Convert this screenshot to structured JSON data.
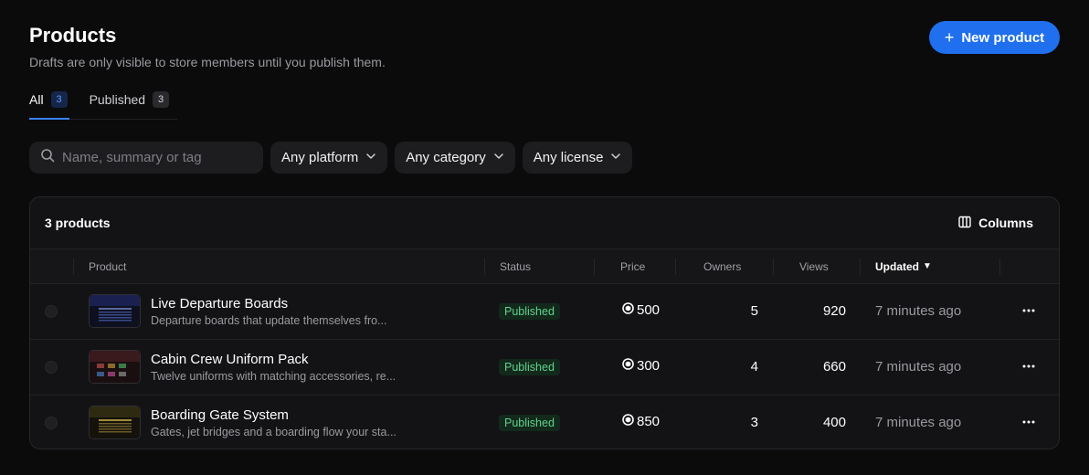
{
  "header": {
    "title": "Products",
    "subtitle": "Drafts are only visible to store members until you publish them.",
    "new_button": "New product"
  },
  "tabs": [
    {
      "label": "All",
      "count": "3",
      "active": true
    },
    {
      "label": "Published",
      "count": "3",
      "active": false
    }
  ],
  "filters": {
    "search_placeholder": "Name, summary or tag",
    "platform": "Any platform",
    "category": "Any category",
    "license": "Any license"
  },
  "table": {
    "count_label": "3 products",
    "columns_button": "Columns",
    "headers": {
      "product": "Product",
      "status": "Status",
      "price": "Price",
      "owners": "Owners",
      "views": "Views",
      "updated": "Updated"
    },
    "sort_indicator": "▼",
    "rows": [
      {
        "name": "Live Departure Boards",
        "summary": "Departure boards that update themselves fro...",
        "status": "Published",
        "price": "500",
        "owners": "5",
        "views": "920",
        "updated": "7 minutes ago",
        "thumb_accent": "#3a4a8a"
      },
      {
        "name": "Cabin Crew Uniform Pack",
        "summary": "Twelve uniforms with matching accessories, re...",
        "status": "Published",
        "price": "300",
        "owners": "4",
        "views": "660",
        "updated": "7 minutes ago",
        "thumb_accent": "#8a3a3a"
      },
      {
        "name": "Boarding Gate System",
        "summary": "Gates, jet bridges and a boarding flow your sta...",
        "status": "Published",
        "price": "850",
        "owners": "3",
        "views": "400",
        "updated": "7 minutes ago",
        "thumb_accent": "#8a7a2a"
      }
    ]
  },
  "colors": {
    "accent": "#1f6fee",
    "status_published": "#5fd38d",
    "background": "#0b0b0c"
  },
  "icons": [
    "plus-icon",
    "search-icon",
    "chevron-down-icon",
    "columns-icon",
    "currency-icon",
    "more-icon"
  ]
}
